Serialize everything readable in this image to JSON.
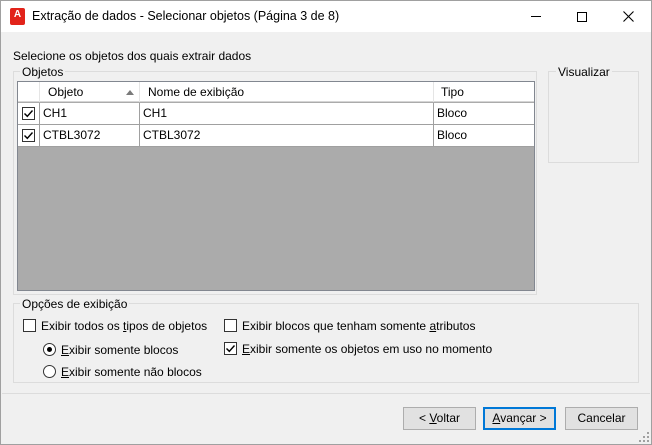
{
  "window": {
    "title": "Extração de dados - Selecionar objetos (Página 3 de 8)",
    "app_icon_letter": "A"
  },
  "prompt": "Selecione os objetos dos quais extrair dados",
  "objects_group": {
    "label": "Objetos",
    "columns": [
      "Objeto",
      "Nome de exibição",
      "Tipo"
    ],
    "sorted_column": "Objeto",
    "rows": [
      {
        "checked": true,
        "object": "CH1",
        "display_name": "CH1",
        "type": "Bloco"
      },
      {
        "checked": true,
        "object": "CTBL3072",
        "display_name": "CTBL3072",
        "type": "Bloco"
      }
    ]
  },
  "preview": {
    "label": "Visualizar"
  },
  "display_options": {
    "label": "Opções de exibição",
    "show_all_types": {
      "pre": "Exibir todos os ",
      "mnemonic": "t",
      "post": "ipos de objetos",
      "checked": false
    },
    "blocks_only": {
      "pre": "",
      "mnemonic": "E",
      "post": "xibir somente blocos",
      "selected": true
    },
    "non_blocks_only": {
      "pre": "",
      "mnemonic": "E",
      "post": "xibir somente não blocos",
      "selected": false
    },
    "blocks_with_attributes": {
      "pre": "Exibir blocos que tenham somente ",
      "mnemonic": "a",
      "post": "tributos",
      "checked": false
    },
    "objects_in_use": {
      "pre": "",
      "mnemonic": "E",
      "post": "xibir somente os objetos em uso no momento",
      "checked": true
    }
  },
  "buttons": {
    "back": {
      "pre": "< ",
      "mnemonic": "V",
      "post": "oltar"
    },
    "next": {
      "pre": "",
      "mnemonic": "A",
      "post": "vançar >"
    },
    "cancel": "Cancelar"
  },
  "colors": {
    "accent": "#0078d7",
    "app_icon": "#e2231a",
    "grid_background": "#ababab"
  }
}
